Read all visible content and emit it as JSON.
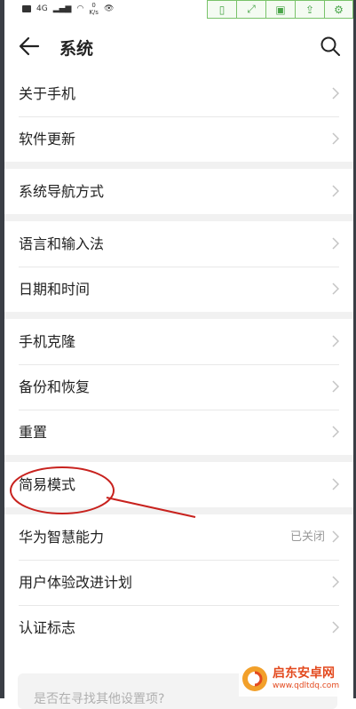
{
  "status_bar": {
    "net_speed_value": "0",
    "net_speed_unit": "K/s",
    "signal": "4G"
  },
  "toolbar": {
    "icons": [
      "phone-frame-icon",
      "fullscreen-icon",
      "save-icon",
      "share-icon",
      "settings-icon"
    ]
  },
  "header": {
    "title": "系统"
  },
  "groups": [
    {
      "rows": [
        {
          "label": "关于手机"
        },
        {
          "label": "软件更新"
        }
      ]
    },
    {
      "rows": [
        {
          "label": "系统导航方式"
        }
      ]
    },
    {
      "rows": [
        {
          "label": "语言和输入法"
        },
        {
          "label": "日期和时间"
        }
      ]
    },
    {
      "rows": [
        {
          "label": "手机克隆"
        },
        {
          "label": "备份和恢复"
        },
        {
          "label": "重置"
        }
      ]
    },
    {
      "rows": [
        {
          "label": "简易模式"
        }
      ]
    },
    {
      "rows": [
        {
          "label": "华为智慧能力",
          "value": "已关闭"
        },
        {
          "label": "用户体验改进计划"
        },
        {
          "label": "认证标志"
        }
      ]
    }
  ],
  "suggestion": {
    "text": "是否在寻找其他设置项?"
  },
  "watermark": {
    "name": "启东安卓网",
    "url": "www.qdltdq.com"
  },
  "colors": {
    "annotation": "#c8221e",
    "chevron": "#c4c4c4",
    "divider": "#e8e8e8",
    "group_gap": "#f1f1f1",
    "watermark": "#e34a1f"
  }
}
